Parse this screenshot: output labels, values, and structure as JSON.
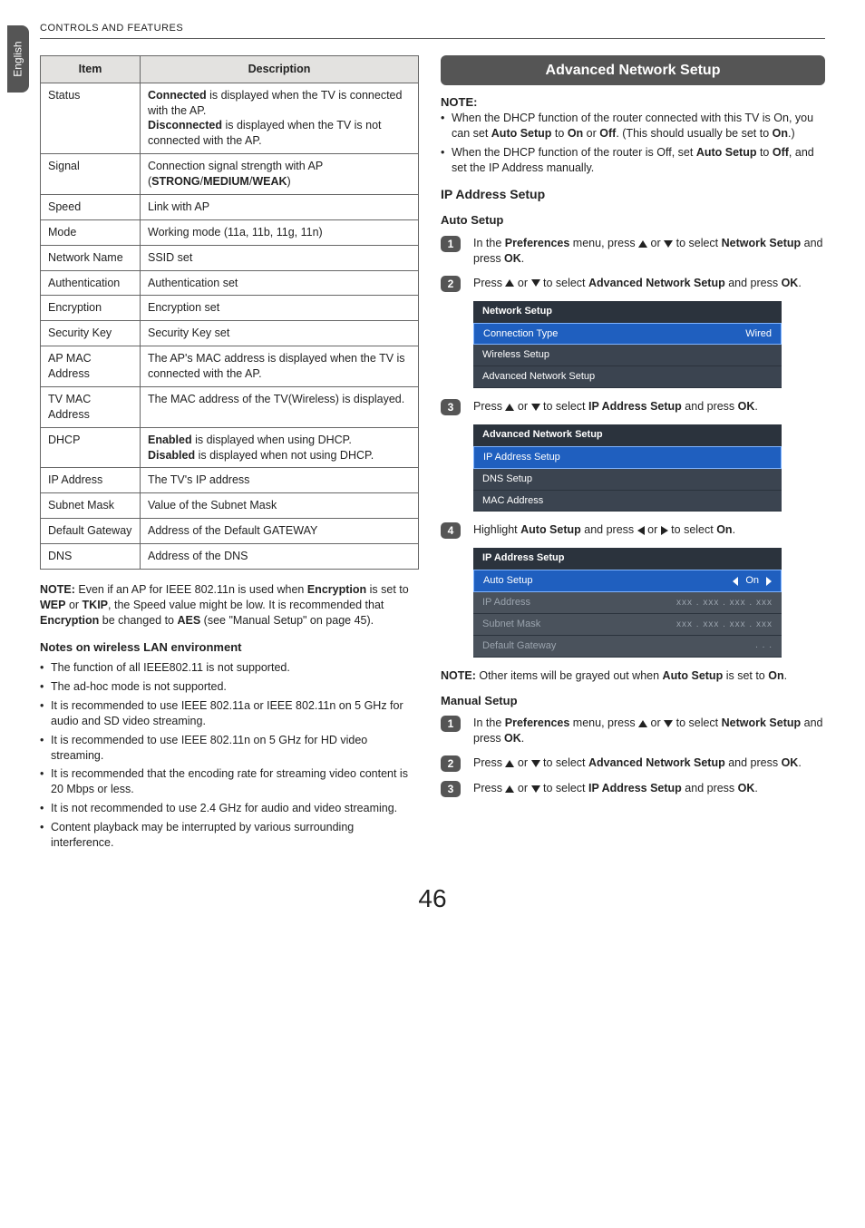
{
  "header": {
    "section_title": "CONTROLS AND FEATURES"
  },
  "side_tab": {
    "label": "English"
  },
  "spec_table": {
    "headers": {
      "item": "Item",
      "description": "Description"
    },
    "rows": [
      {
        "item": "Status",
        "desc_parts": [
          "Connected",
          " is displayed when the TV is connected with the AP.",
          "Disconnected",
          " is displayed when the TV is not connected with the AP."
        ]
      },
      {
        "item": "Signal",
        "desc_parts": [
          "Connection signal strength with AP (",
          "STRONG",
          "/",
          "MEDIUM",
          "/",
          "WEAK",
          ")"
        ]
      },
      {
        "item": "Speed",
        "desc": "Link with AP"
      },
      {
        "item": "Mode",
        "desc": "Working mode (11a, 11b, 11g, 11n)"
      },
      {
        "item": "Network Name",
        "desc": "SSID set"
      },
      {
        "item": "Authentication",
        "desc": "Authentication set"
      },
      {
        "item": "Encryption",
        "desc": "Encryption set"
      },
      {
        "item": "Security Key",
        "desc": "Security Key set"
      },
      {
        "item": "AP MAC Address",
        "desc": "The AP's MAC address is displayed when the TV is connected with the AP."
      },
      {
        "item": "TV MAC Address",
        "desc": "The MAC address of the TV(Wireless) is displayed."
      },
      {
        "item": "DHCP",
        "desc_parts": [
          "Enabled",
          " is displayed when using DHCP.",
          "Disabled",
          " is displayed when not using DHCP."
        ]
      },
      {
        "item": "IP Address",
        "desc": "The TV's IP address"
      },
      {
        "item": "Subnet Mask",
        "desc": "Value of the Subnet Mask"
      },
      {
        "item": "Default Gateway",
        "desc": "Address of the Default GATEWAY"
      },
      {
        "item": "DNS",
        "desc": "Address of the DNS"
      }
    ]
  },
  "left_notes": {
    "note_prefix": "NOTE:",
    "note_text_parts": [
      " Even if an AP for IEEE 802.11n is used when ",
      "Encryption",
      " is set to ",
      "WEP",
      " or ",
      "TKIP",
      ", the Speed value might be low. It is recommended that ",
      "Encryption",
      " be changed to ",
      "AES",
      " (see \"Manual Setup\" on page 45)."
    ],
    "lan_heading": "Notes on wireless LAN environment",
    "bullets": [
      "The function of all IEEE802.11 is not supported.",
      "The ad-hoc mode is not supported.",
      "It is recommended to use IEEE 802.11a or IEEE 802.11n on 5 GHz for audio and SD video streaming.",
      "It is recommended to use IEEE 802.11n on 5 GHz for HD video streaming.",
      "It is recommended that the encoding rate for streaming video content is 20 Mbps or less.",
      "It is not recommended to use 2.4 GHz for audio and video streaming.",
      "Content playback may be interrupted by various surrounding interference."
    ]
  },
  "right": {
    "banner": "Advanced Network Setup",
    "note_label": "NOTE:",
    "note_bullets": [
      {
        "parts": [
          "When the DHCP function of the router connected with this TV is On, you can set ",
          "Auto Setup",
          " to ",
          "On",
          " or ",
          "Off",
          ".",
          " (This should usually be set to ",
          "On",
          ".)"
        ]
      },
      {
        "parts": [
          "When the DHCP function of the router is Off, set ",
          "Auto Setup",
          " to ",
          "Off",
          ", and set the IP Address manually."
        ]
      }
    ],
    "ip_heading": "IP Address Setup",
    "auto_heading": "Auto Setup",
    "steps_auto": [
      {
        "n": "1",
        "parts": [
          "In the ",
          "Preferences",
          " menu, press ",
          "UP",
          " or ",
          "DOWN",
          " to select ",
          "Network Setup",
          " and press ",
          "OK",
          "."
        ]
      },
      {
        "n": "2",
        "parts": [
          "Press ",
          "UP",
          " or ",
          "DOWN",
          " to select ",
          "Advanced Network Setup",
          " and press ",
          "OK",
          "."
        ]
      },
      {
        "n": "3",
        "parts": [
          "Press ",
          "UP",
          " or ",
          "DOWN",
          " to select ",
          "IP Address Setup",
          " and press ",
          "OK",
          "."
        ]
      },
      {
        "n": "4",
        "parts": [
          "Highlight ",
          "Auto Setup",
          " and press ",
          "LEFT",
          " or ",
          "RIGHT",
          " to select ",
          "On",
          "."
        ]
      }
    ],
    "menu1": {
      "title": "Network Setup",
      "rows": [
        {
          "label": "Connection Type",
          "value": "Wired",
          "highlight": true
        },
        {
          "label": "Wireless Setup"
        },
        {
          "label": "Advanced Network Setup"
        }
      ]
    },
    "menu2": {
      "title": "Advanced Network Setup",
      "rows": [
        {
          "label": "IP Address Setup",
          "highlight": true
        },
        {
          "label": "DNS Setup"
        },
        {
          "label": "MAC Address"
        }
      ]
    },
    "menu3": {
      "title": "IP Address Setup",
      "rows": [
        {
          "label": "Auto Setup",
          "value": "On",
          "arrows": true,
          "highlight": true
        },
        {
          "label": "IP Address",
          "ip": "xxx   .   xxx   .   xxx   .   xxx",
          "dim": true
        },
        {
          "label": "Subnet Mask",
          "ip": "xxx   .   xxx   .   xxx   .   xxx",
          "dim": true
        },
        {
          "label": "Default Gateway",
          "ip": ".          .          .",
          "dim": true
        }
      ]
    },
    "note2_prefix": "NOTE:",
    "note2_parts": [
      " Other items will be grayed out when ",
      "Auto Setup",
      " is set to ",
      "On",
      "."
    ],
    "manual_heading": "Manual Setup",
    "steps_manual": [
      {
        "n": "1",
        "parts": [
          "In the ",
          "Preferences",
          " menu, press ",
          "UP",
          " or ",
          "DOWN",
          " to select ",
          "Network Setup",
          " and press ",
          "OK",
          "."
        ]
      },
      {
        "n": "2",
        "parts": [
          "Press ",
          "UP",
          " or ",
          "DOWN",
          " to select ",
          "Advanced Network Setup",
          " and press ",
          "OK",
          "."
        ]
      },
      {
        "n": "3",
        "parts": [
          "Press ",
          "UP",
          " or ",
          "DOWN",
          " to select ",
          "IP Address Setup",
          " and press ",
          "OK",
          "."
        ]
      }
    ]
  },
  "page_number": "46"
}
